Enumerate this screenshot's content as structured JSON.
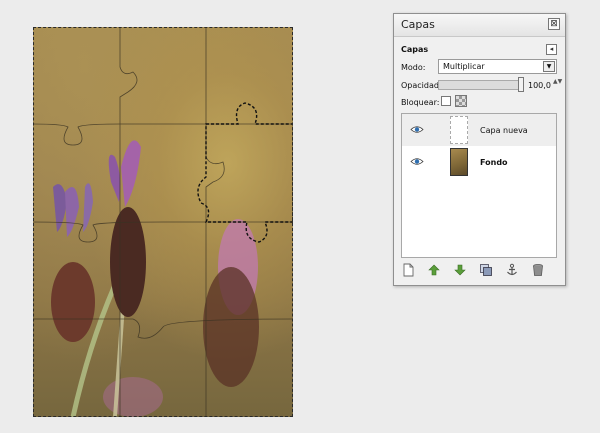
{
  "canvas": {
    "image_subject": "lavender flowers photo with jigsaw puzzle lines"
  },
  "dialog": {
    "title": "Capas",
    "close_glyph": "⊠",
    "tab_label": "Capas",
    "tab_menu_glyph": "◂",
    "mode_label": "Modo:",
    "mode_value": "Multiplicar",
    "mode_arrow": "▼",
    "opacity_label": "Opacidad:",
    "opacity_value": "100,0",
    "opacity_percent": 100,
    "opacity_spin": "▲▼",
    "lock_label": "Bloquear:",
    "layers": [
      {
        "name": "Capa nueva",
        "visible": true,
        "selected": true,
        "icon": "eye-icon"
      },
      {
        "name": "Fondo",
        "visible": true,
        "selected": false,
        "icon": "eye-icon"
      }
    ],
    "toolbar_icons": [
      "new-layer-icon",
      "raise-layer-icon",
      "lower-layer-icon",
      "duplicate-layer-icon",
      "anchor-layer-icon",
      "delete-layer-icon"
    ]
  },
  "colors": {
    "background": "#ececec",
    "accent_green": "#5a9e3a",
    "eye_blue": "#2f6fb0"
  }
}
